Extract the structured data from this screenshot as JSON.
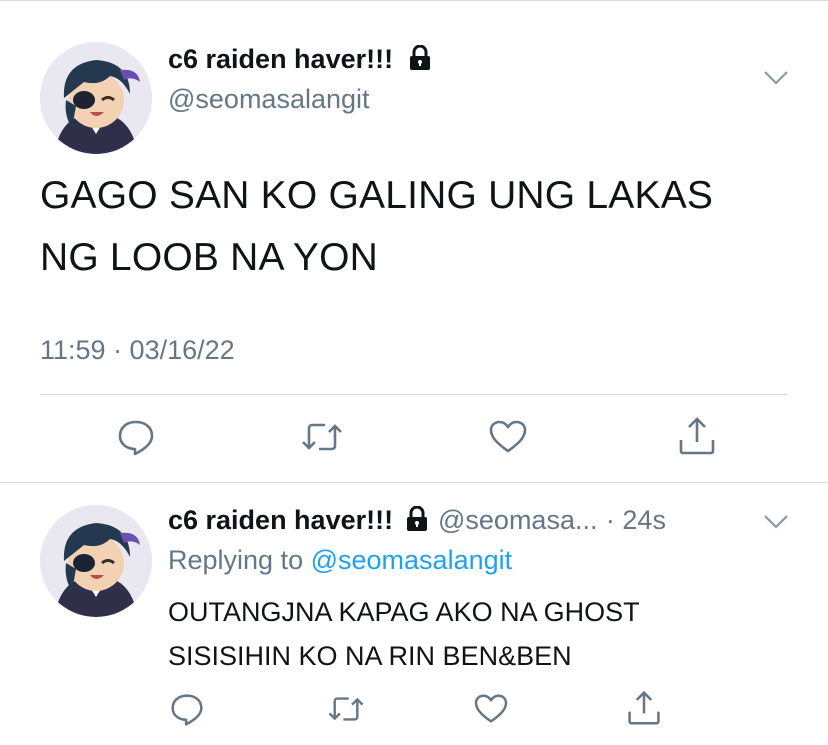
{
  "main_tweet": {
    "display_name": "c6 raiden haver!!!",
    "handle": "@seomasalangit",
    "text_line1": "GAGO SAN KO GALING UNG LAKAS",
    "text_line2": "NG LOOB NA YON",
    "timestamp": "11:59 · 03/16/22",
    "icons": {
      "lock": "lock-icon",
      "more": "chevron-down-icon",
      "reply": "reply-icon",
      "retweet": "retweet-icon",
      "like": "heart-icon",
      "share": "share-icon"
    }
  },
  "reply_tweet": {
    "display_name": "c6 raiden haver!!!",
    "handle_truncated": "@seomasa...",
    "time_ago": "· 24s",
    "replying_to_label": "Replying to",
    "replying_to_handle": "@seomasalangit",
    "text_line1": "OUTANGJNA KAPAG AKO NA GHOST",
    "text_line2": "SISISIHIN KO NA RIN BEN&BEN"
  },
  "colors": {
    "text": "#0f1419",
    "muted": "#657786",
    "link": "#1da1f2",
    "divider": "#cfd9de"
  }
}
